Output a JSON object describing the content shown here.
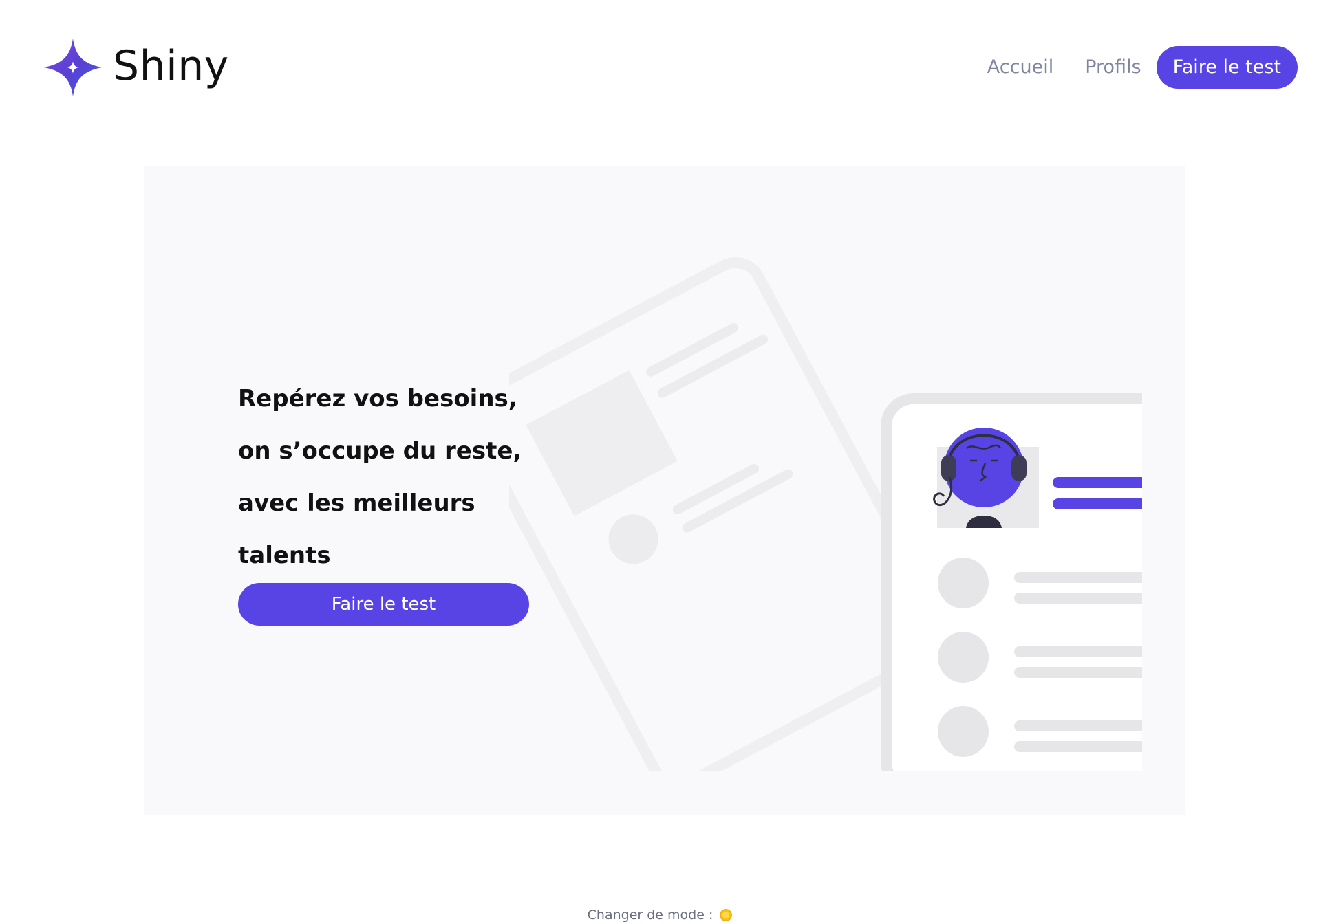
{
  "header": {
    "logo_text": "Shiny",
    "nav": {
      "home_label": "Accueil",
      "profiles_label": "Profils",
      "cta_label": "Faire le test"
    }
  },
  "hero": {
    "title": "Repérez vos besoins, on s’occupe du reste, avec les meilleurs talents",
    "button_label": "Faire le test",
    "illustration_icon": "profile-cards-illustration"
  },
  "footer": {
    "mode_label": "Changer de mode :",
    "mode_icon": "sun-icon"
  },
  "colors": {
    "accent": "#5843e4",
    "nav_text": "#8186a0",
    "hero_background": "#f9f9fc",
    "sun": "#f5c216"
  }
}
